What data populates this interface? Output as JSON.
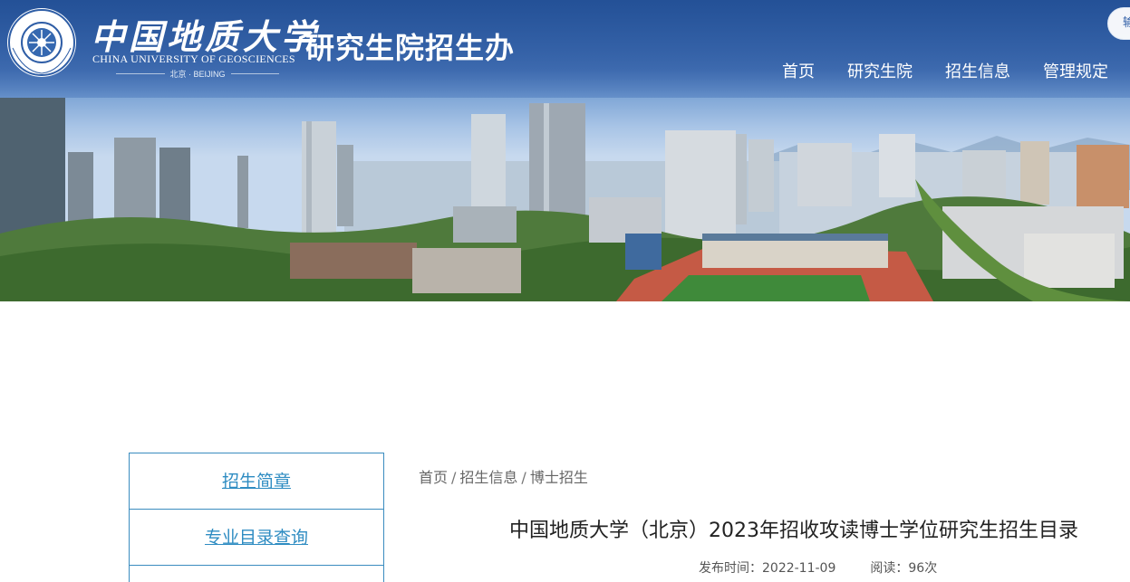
{
  "header": {
    "university_cn": "中国地质大学",
    "university_en": "CHINA UNIVERSITY OF GEOSCIENCES",
    "university_city": "北京 · BEIJING",
    "office_title": "研究生院招生办",
    "top_button": "输",
    "nav": [
      {
        "label": "首页"
      },
      {
        "label": "研究生院"
      },
      {
        "label": "招生信息"
      },
      {
        "label": "管理规定"
      }
    ]
  },
  "sidebar": {
    "items": [
      {
        "label": "招生简章"
      },
      {
        "label": "专业目录查询"
      },
      {
        "label": ""
      }
    ]
  },
  "breadcrumb": {
    "items": [
      "首页",
      "招生信息",
      "博士招生"
    ],
    "separator": "/"
  },
  "article": {
    "title": "中国地质大学（北京）2023年招收攻读博士学位研究生招生目录",
    "publish_label": "发布时间：",
    "publish_date": "2022-11-09",
    "views_label": "阅读：",
    "views": "96次"
  },
  "colors": {
    "header_blue": "#2f5ea6",
    "sidebar_border": "#3a8cbf",
    "sidebar_text": "#2e8cc2"
  }
}
